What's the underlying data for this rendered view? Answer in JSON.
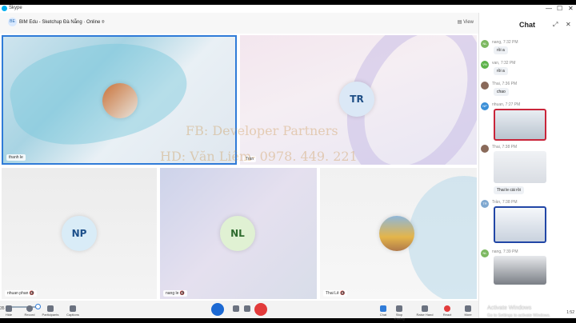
{
  "window": {
    "title": "Skype",
    "minimize": "—",
    "maximize": "☐",
    "close": "✕"
  },
  "call": {
    "badge": "BE",
    "name": "BIM Edu - Sketchup Đà Nẵng · Online ⌾",
    "view_label": "View"
  },
  "participants": [
    {
      "label": "thanh le",
      "initials": ""
    },
    {
      "label": "Trần",
      "initials": "TR"
    },
    {
      "label": "nhuan phan 🔇",
      "initials": "NP"
    },
    {
      "label": "nang le 🔇",
      "initials": "NL"
    },
    {
      "label": "Thai Lê 🔇",
      "initials": ""
    }
  ],
  "watermark": {
    "line1": "FB: Developer Partners",
    "line2": "HD: Văn Liêm- 0978. 449. 221"
  },
  "controls": {
    "hide": "Hide",
    "record": "Record",
    "participants": "Participants",
    "captions": "Captions",
    "chat": "Chat",
    "stop_sharing": "Stop sharing",
    "raise_hand": "Raise Hand",
    "react": "React",
    "more": "More",
    "left_clock": "35",
    "right_clock": "1:52"
  },
  "chat": {
    "title": "Chat",
    "messages": [
      {
        "avatar": "NL",
        "meta": "nang, 7:32 PM",
        "text": "rồi a"
      },
      {
        "avatar": "VN",
        "meta": "van, 7:32 PM",
        "text": "rồi a"
      },
      {
        "avatar": "",
        "meta": "Thai, 7:36 PM",
        "text": "chao"
      },
      {
        "avatar": "NP",
        "meta": "nhuan, 7:27 PM",
        "text": ""
      },
      {
        "avatar": "",
        "meta": "Thai, 7:38 PM",
        "text": "Thai le cài rồi"
      },
      {
        "avatar": "TR",
        "meta": "Trần, 7:38 PM",
        "text": ""
      },
      {
        "avatar": "NL",
        "meta": "nang, 7:39 PM",
        "text": ""
      }
    ]
  },
  "os_overlay": {
    "activate_title": "Activate Windows",
    "activate_sub": "Go to Settings to activate Windows."
  },
  "colors": {
    "accent": "#2f7bd8",
    "end_call": "#e23b3b",
    "mic": "#1c69d3",
    "np_avatar_text": "#1c4f8a",
    "nl_avatar_text": "#2f6b2f"
  }
}
